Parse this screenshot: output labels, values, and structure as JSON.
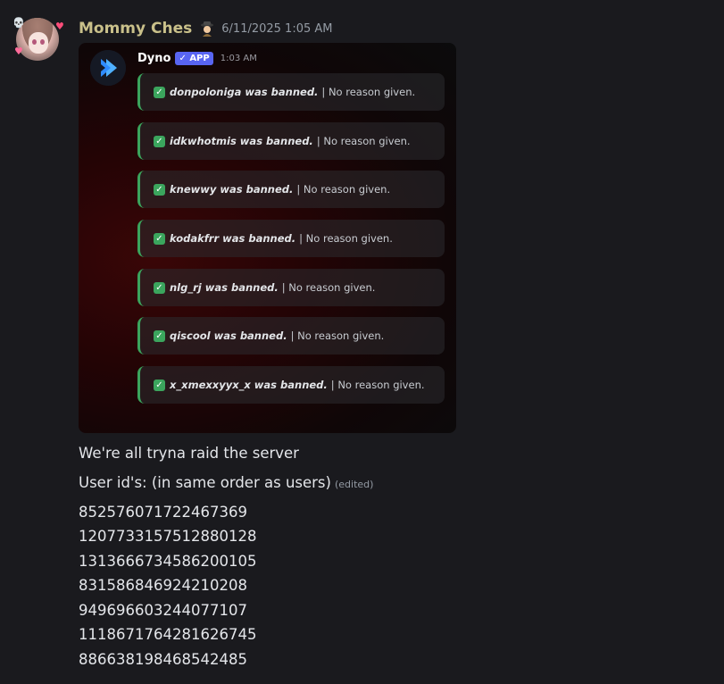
{
  "message": {
    "author": "Mommy Ches",
    "timestamp": "6/11/2025 1:05 AM",
    "avatar_icon": "anime-girl-avatar",
    "role_icon": "detective-icon",
    "username_color": "#c9c08a"
  },
  "embed": {
    "bot_name": "Dyno",
    "badge": "✓ APP",
    "time": "1:03 AM",
    "accent_color": "#3ba55d",
    "bans": [
      {
        "user": "donpoloniga was banned.",
        "reason": "| No reason given."
      },
      {
        "user": "idkwhotmis was banned.",
        "reason": "| No reason given."
      },
      {
        "user": "knewwy was banned.",
        "reason": "| No reason given."
      },
      {
        "user": "kodakfrr was banned.",
        "reason": "| No reason given."
      },
      {
        "user": "nlg_rj was banned.",
        "reason": "| No reason given."
      },
      {
        "user": "qiscool was banned.",
        "reason": "| No reason given."
      },
      {
        "user": "x_xmexxyyx_x was banned.",
        "reason": "| No reason given."
      }
    ]
  },
  "content": {
    "line1": "We're all tryna raid the server",
    "line2": "User id's: (in same order as users)",
    "edited": "(edited)",
    "ids": [
      "852576071722467369",
      "1207733157512880128",
      "1313666734586200105",
      "831586846924210208",
      "949696603244077107",
      "1118671764281626745",
      "886638198468542485"
    ]
  }
}
